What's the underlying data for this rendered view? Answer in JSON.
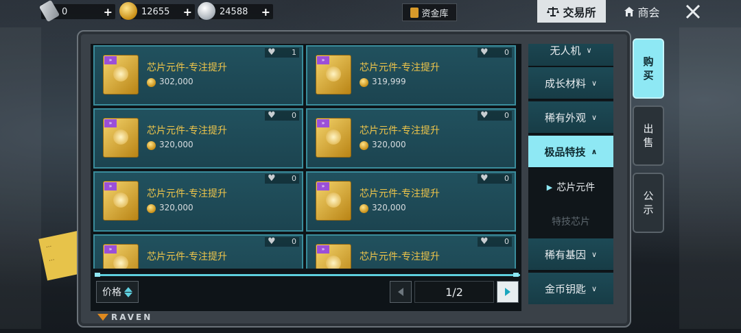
{
  "currencies": [
    {
      "icon": "ticket-icon",
      "value": "0"
    },
    {
      "icon": "gold-coin-icon",
      "value": "12655"
    },
    {
      "icon": "silver-coin-icon",
      "value": "24588"
    }
  ],
  "top": {
    "fund_label": "资金库",
    "trade_label": "交易所",
    "shop_label": "商会"
  },
  "items": [
    {
      "name": "芯片元件-专注提升",
      "price": "302,000",
      "likes": "1"
    },
    {
      "name": "芯片元件-专注提升",
      "price": "319,999",
      "likes": "0"
    },
    {
      "name": "芯片元件-专注提升",
      "price": "320,000",
      "likes": "0"
    },
    {
      "name": "芯片元件-专注提升",
      "price": "320,000",
      "likes": "0"
    },
    {
      "name": "芯片元件-专注提升",
      "price": "320,000",
      "likes": "0"
    },
    {
      "name": "芯片元件-专注提升",
      "price": "320,000",
      "likes": "0"
    },
    {
      "name": "芯片元件-专注提升",
      "price": "",
      "likes": "0"
    },
    {
      "name": "芯片元件-专注提升",
      "price": "",
      "likes": "0"
    }
  ],
  "categories": {
    "drone": "无人机",
    "growth": "成长材料",
    "rare_skin": "稀有外观",
    "premium_skill": "极品特技",
    "sub_chip_component": "芯片元件",
    "sub_skill_chip": "特技芯片",
    "rare_gene": "稀有基因",
    "gold_key": "金币钥匙"
  },
  "side_tabs": {
    "buy": [
      "购",
      "买"
    ],
    "sell": [
      "出",
      "售"
    ],
    "notice": [
      "公",
      "示"
    ]
  },
  "sort_label": "价格",
  "pager": {
    "label": "1/2"
  },
  "brand": "RAVEN",
  "colors": {
    "accent": "#8ee8f4",
    "item_name": "#f0c64a",
    "card_border": "#3a8d9c"
  }
}
